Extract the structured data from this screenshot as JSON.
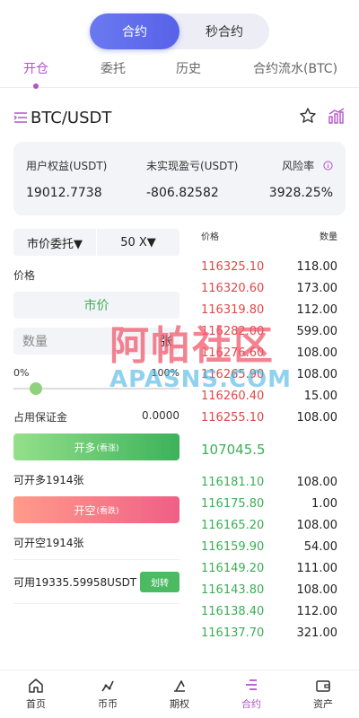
{
  "header": {
    "segments": [
      "合约",
      "秒合约"
    ],
    "active_segment": 0
  },
  "tabs": [
    "开仓",
    "委托",
    "历史",
    "合约流水(BTC)"
  ],
  "pair": {
    "name": "BTC/USDT"
  },
  "stats": {
    "equity_label": "用户权益(USDT)",
    "equity_value": "19012.7738",
    "pnl_label": "未实现盈亏(USDT)",
    "pnl_value": "-806.82582",
    "risk_label": "风险率",
    "risk_value": "3928.25%"
  },
  "form": {
    "order_type": "市价委托▼",
    "leverage": "50 X▼",
    "price_label": "价格",
    "price_value": "市价",
    "qty_placeholder": "数量",
    "qty_unit": "张",
    "slider_min": "0%",
    "slider_max": "100%",
    "margin_label": "占用保证金",
    "margin_value": "0.0000",
    "long_label": "开多",
    "long_sub": "(看涨)",
    "can_long": "可开多1914张",
    "short_label": "开空",
    "short_sub": "(看跌)",
    "can_short": "可开空1914张",
    "available": "可用19335.59958USDT",
    "transfer": "划转"
  },
  "orderbook": {
    "price_header": "价格",
    "qty_header": "数量",
    "asks": [
      {
        "p": "116325.10",
        "q": "118.00"
      },
      {
        "p": "116320.60",
        "q": "173.00"
      },
      {
        "p": "116319.80",
        "q": "112.00"
      },
      {
        "p": "116282.00",
        "q": "599.00"
      },
      {
        "p": "116276.60",
        "q": "108.00"
      },
      {
        "p": "116265.90",
        "q": "108.00"
      },
      {
        "p": "116260.40",
        "q": "15.00"
      },
      {
        "p": "116255.10",
        "q": "108.00"
      }
    ],
    "last_price": "107045.5",
    "bids": [
      {
        "p": "116181.10",
        "q": "108.00"
      },
      {
        "p": "116175.80",
        "q": "1.00"
      },
      {
        "p": "116165.20",
        "q": "108.00"
      },
      {
        "p": "116159.90",
        "q": "54.00"
      },
      {
        "p": "116149.20",
        "q": "111.00"
      },
      {
        "p": "116143.80",
        "q": "108.00"
      },
      {
        "p": "116138.40",
        "q": "112.00"
      },
      {
        "p": "116137.70",
        "q": "321.00"
      }
    ]
  },
  "watermark": {
    "cn": "阿帕社区",
    "en": "APASNS.COM"
  },
  "nav": [
    "首页",
    "币币",
    "期权",
    "合约",
    "资产"
  ],
  "colors": {
    "accent": "#b453c9",
    "red": "#e04848",
    "green": "#3cae55",
    "blue": "#5762e8"
  }
}
